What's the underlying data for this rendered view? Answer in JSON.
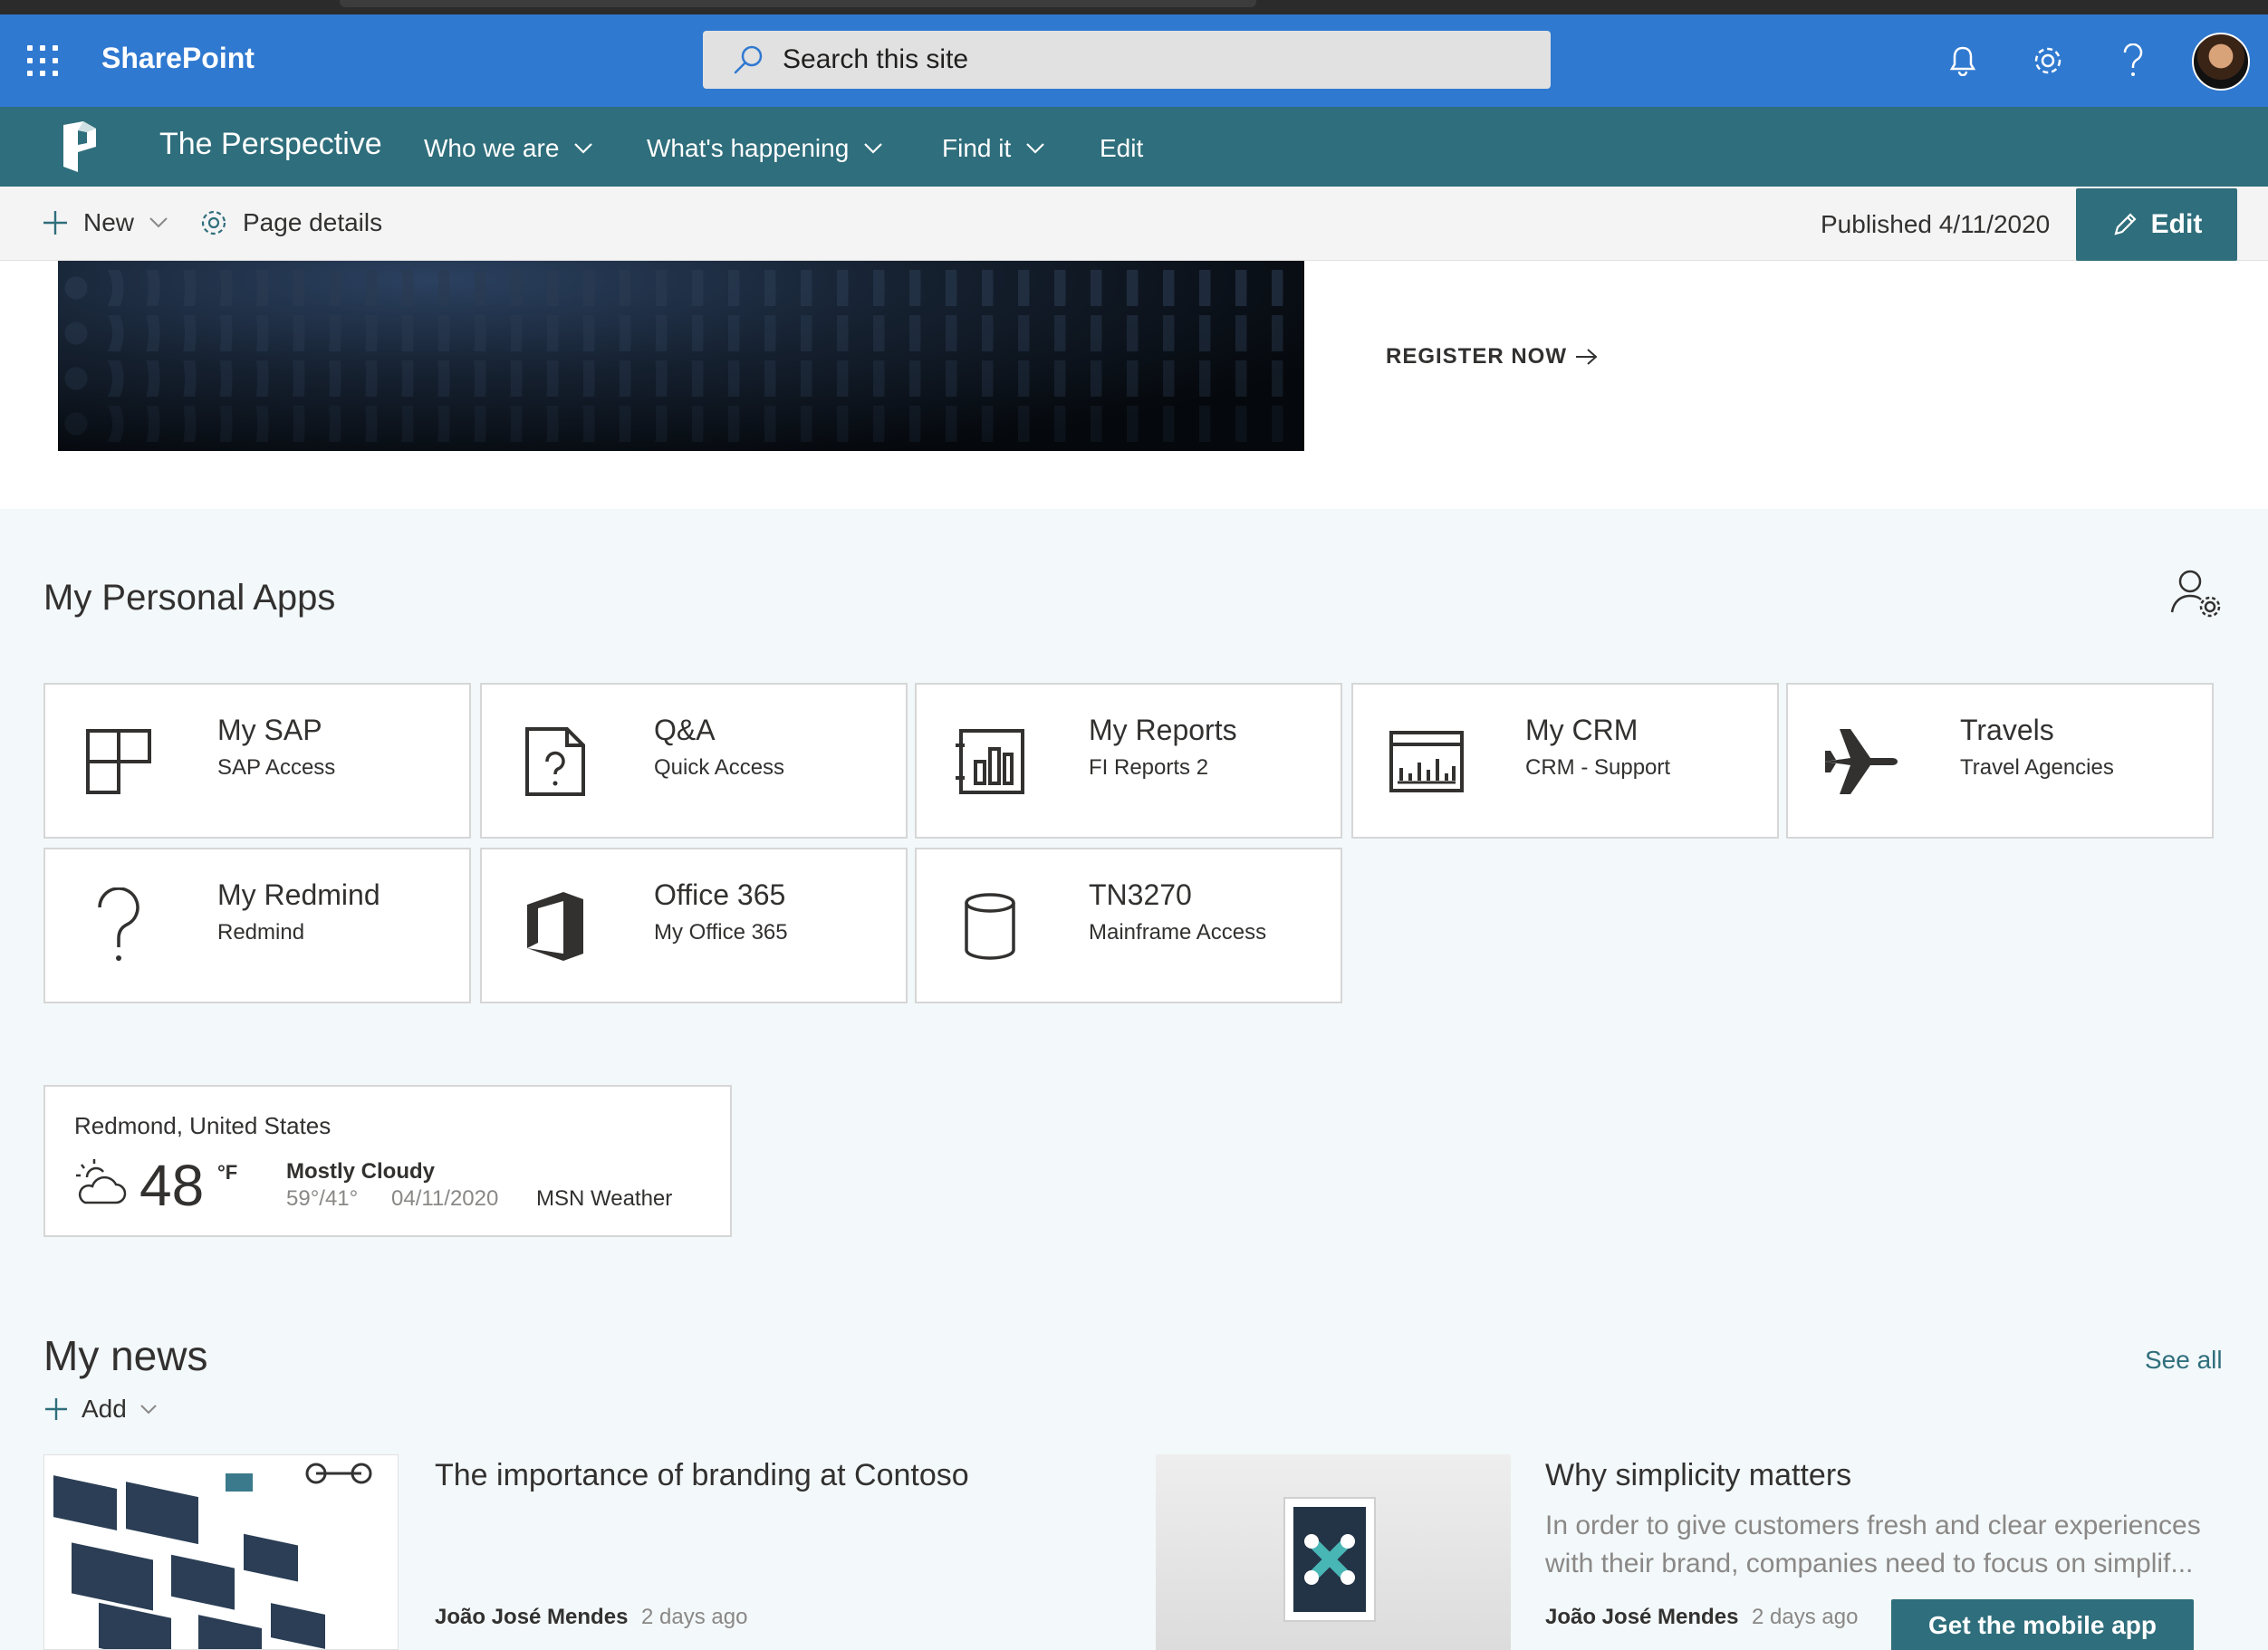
{
  "suite": {
    "brand": "SharePoint",
    "search_placeholder": "Search this site"
  },
  "hub": {
    "site_title": "The Perspective",
    "nav": [
      {
        "label": "Who we are"
      },
      {
        "label": "What's happening"
      },
      {
        "label": "Find it"
      },
      {
        "label": "Edit"
      }
    ]
  },
  "command_bar": {
    "new_label": "New",
    "page_details_label": "Page details",
    "published": "Published 4/11/2020",
    "edit_label": "Edit"
  },
  "hero": {
    "register_label": "REGISTER NOW"
  },
  "personal_apps": {
    "title": "My Personal Apps",
    "tiles": [
      {
        "title": "My SAP",
        "subtitle": "SAP Access",
        "icon": "grid-icon"
      },
      {
        "title": "Q&A",
        "subtitle": "Quick Access",
        "icon": "document-question-icon"
      },
      {
        "title": "My Reports",
        "subtitle": "FI Reports 2",
        "icon": "report-icon"
      },
      {
        "title": "My CRM",
        "subtitle": "CRM - Support",
        "icon": "chart-icon"
      },
      {
        "title": "Travels",
        "subtitle": "Travel Agencies",
        "icon": "airplane-icon"
      },
      {
        "title": "My Redmind",
        "subtitle": "Redmind",
        "icon": "question-icon"
      },
      {
        "title": "Office 365",
        "subtitle": "My Office 365",
        "icon": "office-icon"
      },
      {
        "title": "TN3270",
        "subtitle": "Mainframe Access",
        "icon": "database-icon"
      }
    ]
  },
  "weather": {
    "location": "Redmond, United States",
    "temperature": "48",
    "unit": "°F",
    "condition": "Mostly Cloudy",
    "high_low": "59°/41°",
    "date": "04/11/2020",
    "source": "MSN Weather"
  },
  "news": {
    "title": "My news",
    "see_all": "See all",
    "add_label": "Add",
    "items": [
      {
        "title": "The importance of branding at Contoso",
        "description": "",
        "author": "João José Mendes",
        "time": "2 days ago"
      },
      {
        "title": "Why simplicity matters",
        "description": "In order to give customers fresh and clear experiences with their brand, companies need to focus on simplif...",
        "author": "João José Mendes",
        "time": "2 days ago"
      }
    ],
    "mobile_app_label": "Get the mobile app"
  },
  "colors": {
    "suite_bar": "#3079d0",
    "hub_nav": "#2f6e7c",
    "accent": "#2f6e7c",
    "page_bg": "#f3f8fa"
  }
}
